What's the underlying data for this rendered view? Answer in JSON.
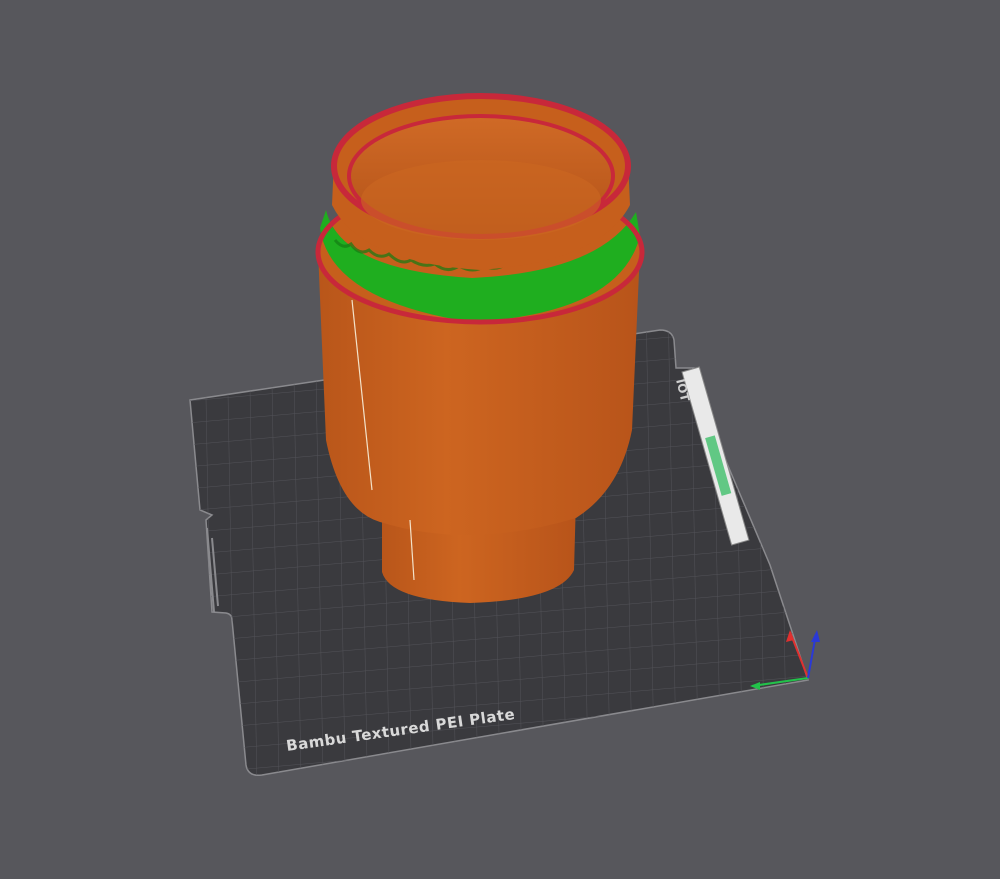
{
  "viewport": {
    "background_color": "#57575c",
    "view": "3d-perspective-preview"
  },
  "build_plate": {
    "label": "Bambu Textured PEI Plate",
    "logo_text": "IOT",
    "surface_color": "#3a3a3e",
    "grid_color": "#55555b",
    "outline_color": "#8a8a8e"
  },
  "model": {
    "shape": "cup",
    "body_color": "#c65f1c",
    "rim_color": "#c8283a",
    "support_color": "#1fae1f"
  },
  "axes": {
    "x_color": "#e0302f",
    "y_color": "#22c24a",
    "z_color": "#2a39d6"
  }
}
